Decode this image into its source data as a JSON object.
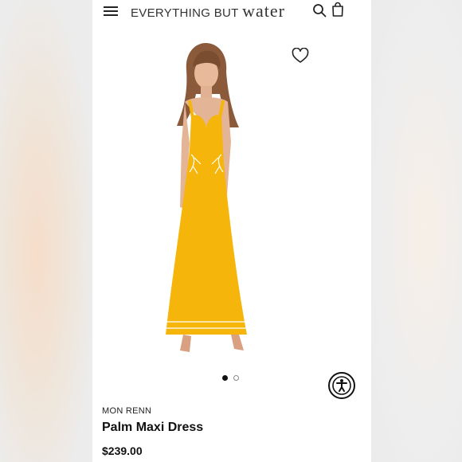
{
  "header": {
    "logo_part1": "EVERYTHING BUT",
    "logo_part2": "water",
    "menu_icon": "hamburger-menu-icon",
    "search_icon": "search-icon",
    "bag_icon": "shopping-bag-icon"
  },
  "gallery": {
    "favorite_icon": "heart-icon",
    "image_name": "product-photo",
    "dress_color": "#f5b50a",
    "active_slide": 1,
    "slide_count": 2
  },
  "accessibility": {
    "icon": "accessibility-icon"
  },
  "product": {
    "brand": "MON RENN",
    "name": "Palm Maxi Dress",
    "price": "$239.00"
  }
}
